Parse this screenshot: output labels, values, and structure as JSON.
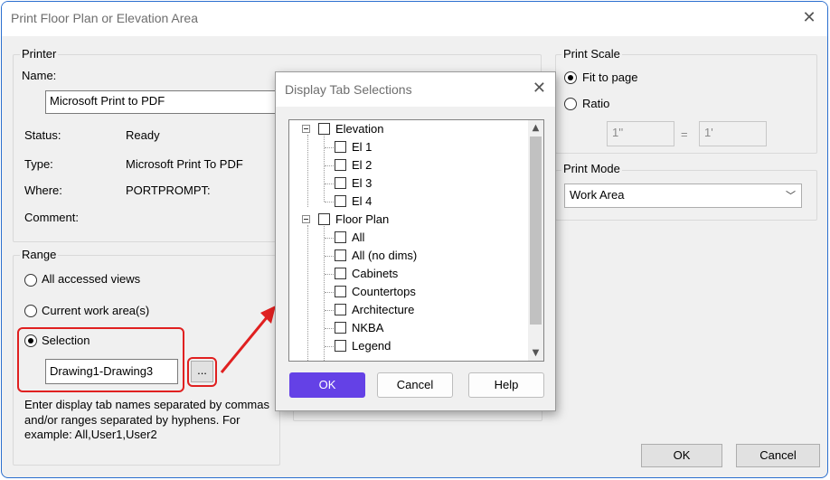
{
  "window": {
    "title": "Print Floor Plan or Elevation Area"
  },
  "printer": {
    "group_label": "Printer",
    "name_label": "Name:",
    "name_value": "Microsoft Print to PDF",
    "status_label": "Status:",
    "status_value": "Ready",
    "type_label": "Type:",
    "type_value": "Microsoft Print To PDF",
    "where_label": "Where:",
    "where_value": "PORTPROMPT:",
    "comment_label": "Comment:"
  },
  "range": {
    "group_label": "Range",
    "options": [
      {
        "label": "All accessed views",
        "selected": false
      },
      {
        "label": "Current work area(s)",
        "selected": false
      },
      {
        "label": "Selection",
        "selected": true
      }
    ],
    "selection_value": "Drawing1-Drawing3",
    "browse_label": "...",
    "help_text_1": "Enter display tab names separated by commas",
    "help_text_2": "and/or ranges separated by hyphens. For",
    "help_text_3": "example: All,User1,User2"
  },
  "print_scale": {
    "group_label": "Print Scale",
    "options": [
      {
        "label": "Fit to page",
        "selected": true
      },
      {
        "label": "Ratio",
        "selected": false
      }
    ],
    "ratio_left": "1''",
    "ratio_equals": "=",
    "ratio_right": "1'"
  },
  "print_mode": {
    "group_label": "Print Mode",
    "value": "Work Area"
  },
  "buttons": {
    "ok": "OK",
    "cancel": "Cancel"
  },
  "popup": {
    "title": "Display Tab Selections",
    "tree": [
      {
        "label": "Elevation",
        "level": 0
      },
      {
        "label": "El 1",
        "level": 1
      },
      {
        "label": "El 2",
        "level": 1
      },
      {
        "label": "El 3",
        "level": 1
      },
      {
        "label": "El 4",
        "level": 1
      },
      {
        "label": "Floor Plan",
        "level": 0
      },
      {
        "label": "All",
        "level": 1
      },
      {
        "label": "All (no dims)",
        "level": 1
      },
      {
        "label": "Cabinets",
        "level": 1
      },
      {
        "label": "Countertops",
        "level": 1
      },
      {
        "label": "Architecture",
        "level": 1
      },
      {
        "label": "NKBA",
        "level": 1
      },
      {
        "label": "Legend",
        "level": 1
      }
    ],
    "ok": "OK",
    "cancel": "Cancel",
    "help": "Help"
  },
  "colors": {
    "accent": "#6441e6",
    "highlight": "#e02020",
    "border": "#2b6fcf"
  }
}
